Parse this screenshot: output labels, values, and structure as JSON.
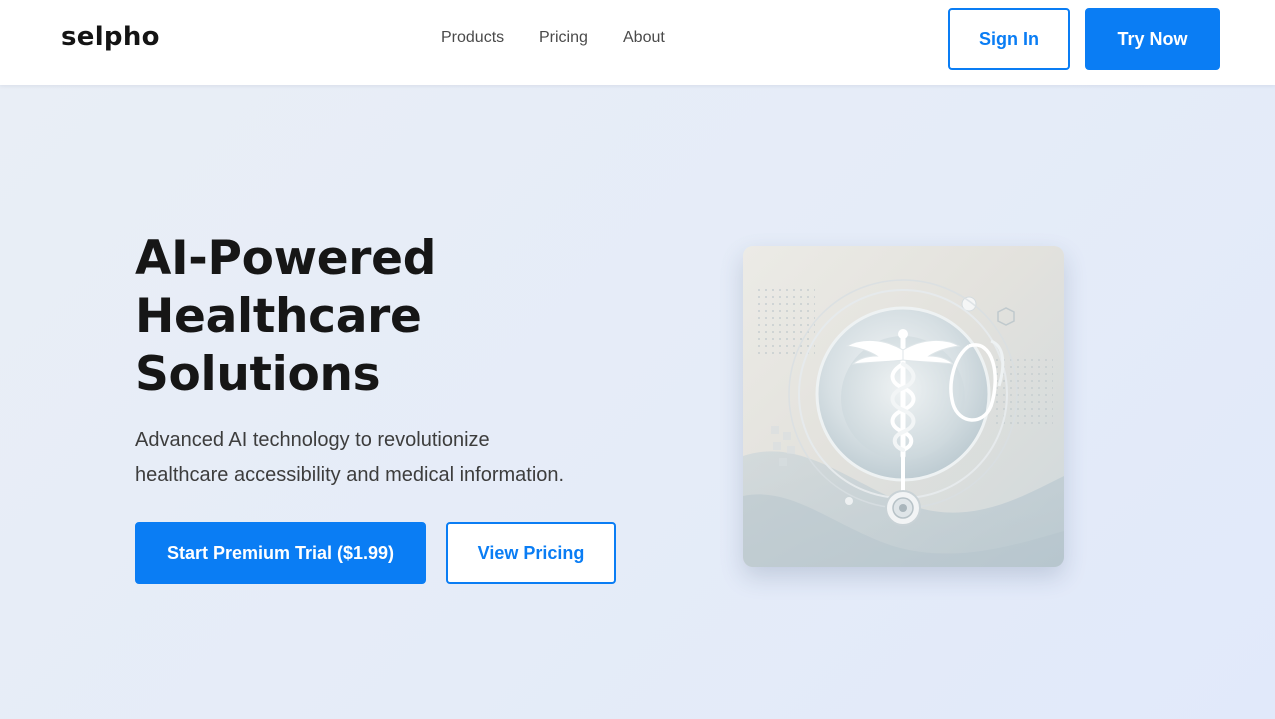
{
  "brand": {
    "logo_text": "selpho"
  },
  "nav": {
    "items": [
      {
        "label": "Products"
      },
      {
        "label": "Pricing"
      },
      {
        "label": "About"
      }
    ]
  },
  "header_actions": {
    "sign_in_label": "Sign In",
    "try_now_label": "Try Now"
  },
  "hero": {
    "title_lines": [
      "AI-Powered",
      "Healthcare",
      "Solutions"
    ],
    "subtitle_lines": [
      "Advanced AI technology to revolutionize",
      "healthcare accessibility and medical information."
    ],
    "primary_cta_label": "Start Premium Trial ($1.99)",
    "secondary_cta_label": "View Pricing",
    "illustration": {
      "icons": [
        "caduceus-icon",
        "stethoscope-icon"
      ]
    }
  },
  "colors": {
    "accent": "#0a7df4",
    "heading": "#161616",
    "hero_background": "#e8eef8"
  }
}
